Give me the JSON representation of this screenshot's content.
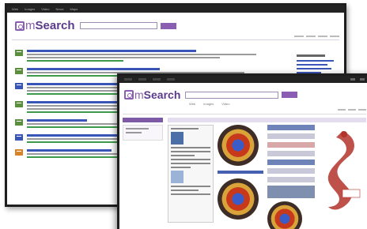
{
  "back_window": {
    "logo_text": "mSearch",
    "top_menu": [
      "Web",
      "Images",
      "Video",
      "News",
      "Maps"
    ],
    "results_count": 7
  },
  "front_window": {
    "logo_text": "mSearch",
    "tabs": [
      "Web",
      "Images",
      "Video"
    ]
  },
  "colors": {
    "brand_purple": "#8a5fb3",
    "link_blue": "#3a55b8",
    "url_green": "#3d9a4a",
    "seal_red": "#c8391c",
    "seal_blue": "#3a5cc8",
    "dragon_red": "#b3322a"
  },
  "icons": {
    "logo": "magnifier-square-icon",
    "favicon": "document-icon"
  }
}
